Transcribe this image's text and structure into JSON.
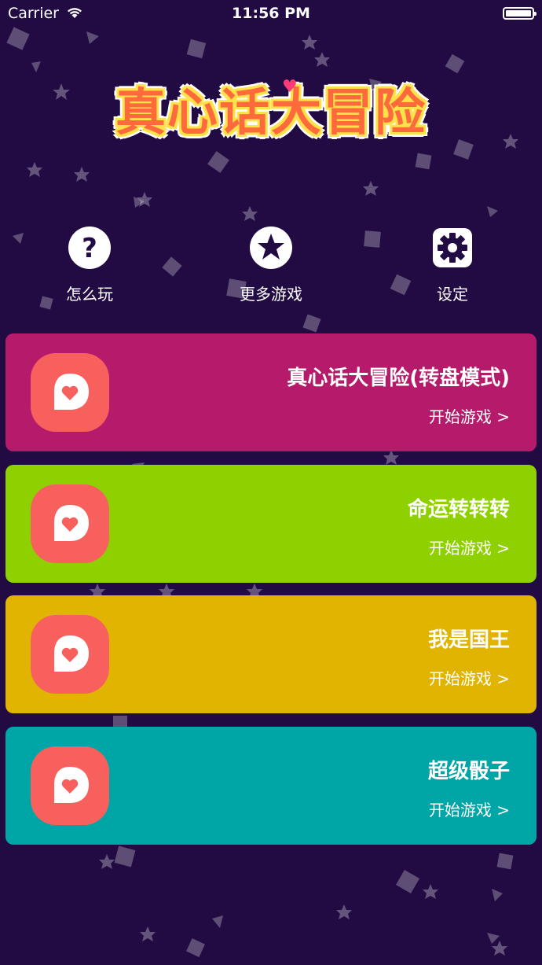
{
  "status_bar": {
    "carrier": "Carrier",
    "time": "11:56 PM"
  },
  "logo": {
    "text": "真心话大冒险"
  },
  "top_nav": [
    {
      "label": "怎么玩",
      "icon": "question-icon"
    },
    {
      "label": "更多游戏",
      "icon": "star-icon"
    },
    {
      "label": "设定",
      "icon": "gear-icon"
    }
  ],
  "games": [
    {
      "title": "真心话大冒险(转盘模式)",
      "action": "开始游戏 >",
      "color": "#b51b6a",
      "icon": "chat-heart-icon"
    },
    {
      "title": "命运转转转",
      "action": "开始游戏 >",
      "color": "#8fd100",
      "icon": "chat-heart-icon"
    },
    {
      "title": "我是国王",
      "action": "开始游戏 >",
      "color": "#e0b400",
      "icon": "chat-heart-icon"
    },
    {
      "title": "超级骰子",
      "action": "开始游戏 >",
      "color": "#00a6a6",
      "icon": "chat-heart-icon"
    }
  ],
  "colors": {
    "background": "#210b42",
    "badge": "#f8605d",
    "logo_fill": "#ff6a3d",
    "logo_outline": "#ffe14a"
  }
}
